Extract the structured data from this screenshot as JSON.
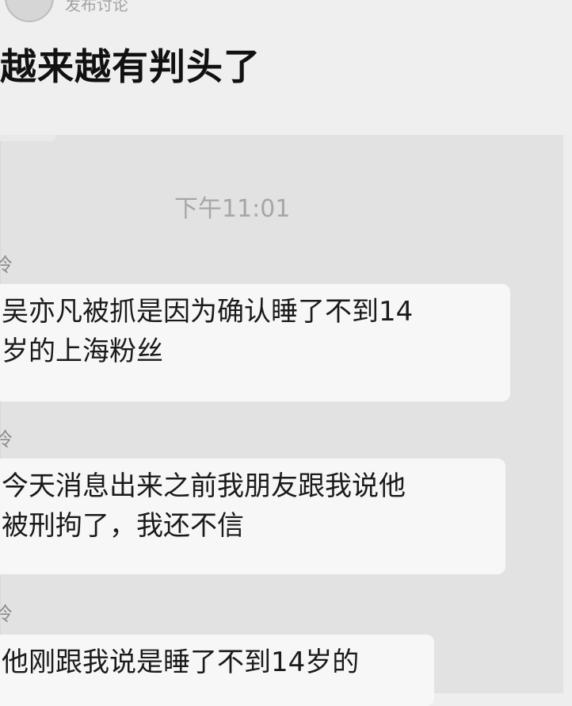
{
  "post": {
    "meta": "发布讨论",
    "text": "越来越有判头了"
  },
  "chat": {
    "timestamp": "下午11:01",
    "messages": [
      {
        "sender": "冷",
        "lines": [
          "吴亦凡被抓是因为确认睡了不到14",
          "岁的上海粉丝"
        ]
      },
      {
        "sender": "冷",
        "lines": [
          "今天消息出来之前我朋友跟我说他",
          "被刑拘了，我还不信"
        ]
      },
      {
        "sender": "冷",
        "lines": [
          "他刚跟我说是睡了不到14岁的"
        ]
      }
    ]
  }
}
